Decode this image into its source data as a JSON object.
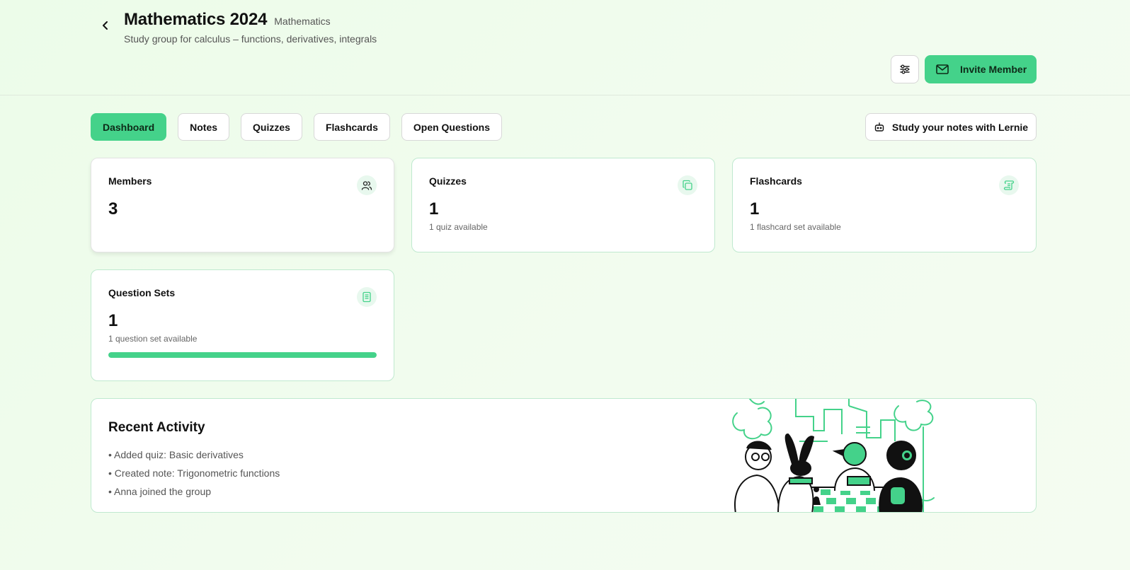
{
  "header": {
    "title": "Mathematics 2024",
    "subject": "Mathematics",
    "description": "Study group for calculus – functions, derivatives, integrals",
    "invite_label": "Invite Member"
  },
  "tabs": [
    {
      "label": "Dashboard",
      "active": true
    },
    {
      "label": "Notes",
      "active": false
    },
    {
      "label": "Quizzes",
      "active": false
    },
    {
      "label": "Flashcards",
      "active": false
    },
    {
      "label": "Open Questions",
      "active": false
    }
  ],
  "lernie_label": "Study your notes with Lernie",
  "cards": {
    "members": {
      "title": "Members",
      "value": "3"
    },
    "quizzes": {
      "title": "Quizzes",
      "value": "1",
      "sub": "1 quiz available"
    },
    "flashcards": {
      "title": "Flashcards",
      "value": "1",
      "sub": "1 flashcard set available"
    },
    "question_sets": {
      "title": "Question Sets",
      "value": "1",
      "sub": "1 question set available",
      "progress_percent": 100
    }
  },
  "activity": {
    "title": "Recent Activity",
    "items": [
      "• Added quiz: Basic derivatives",
      "• Created note: Trigonometric functions",
      "• Anna joined the group"
    ]
  },
  "colors": {
    "accent": "#44d28a",
    "card_border": "#bfe9cf",
    "background": "#ecfce9"
  },
  "icons": {
    "back": "chevron-left-icon",
    "settings": "sliders-icon",
    "invite": "mail-icon",
    "lernie": "robot-icon",
    "members": "users-icon",
    "quizzes": "copy-icon",
    "flashcards": "scroll-icon",
    "question_sets": "notebook-icon"
  }
}
